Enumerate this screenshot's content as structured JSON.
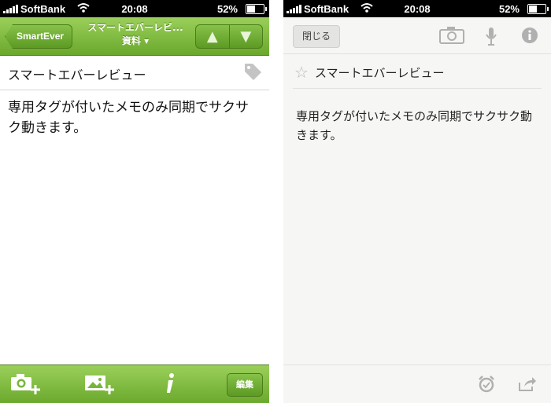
{
  "status": {
    "carrier": "SoftBank",
    "time": "20:08",
    "battery": "52%",
    "battery_level": 0.52
  },
  "smartever": {
    "back_label": "SmartEver",
    "title": "スマートエバーレビ...",
    "notebook": "資料",
    "note_title": "スマートエバーレビュー",
    "note_body": "専用タグが付いたメモのみ同期でサクサク動きます。",
    "edit_label": "編集"
  },
  "evernote": {
    "close_label": "閉じる",
    "note_title": "スマートエバーレビュー",
    "note_body": "専用タグが付いたメモのみ同期でサクサク動きます。"
  },
  "colors": {
    "green_top": "#9bd05a",
    "green_bottom": "#6aa82c",
    "icon_gray": "#b0b0b0"
  }
}
